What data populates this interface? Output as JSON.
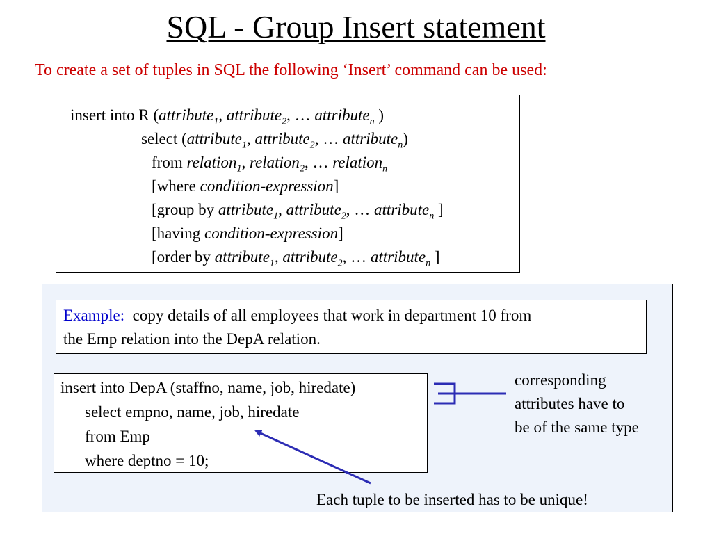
{
  "title": "SQL - Group Insert statement",
  "subtitle": "To create a set of tuples in SQL the following ‘Insert’ command can be used:",
  "colors": {
    "subtitle": "#cc0000",
    "example_label": "#0000cc",
    "panel_background": "#eef3fb",
    "connector": "#2c2cb4"
  },
  "syntax": {
    "insert_into": "insert into R (",
    "select": "select (",
    "from": "from ",
    "where_open": "[where ",
    "group_by_open": "[group by ",
    "having_open": "[having ",
    "order_by_open": "[order by ",
    "attribute": "attribute",
    "relation": "relation",
    "condition_expression": "condition-expression",
    "sub_1": "1",
    "sub_2": "2",
    "sub_n": "n",
    "comma": ", ",
    "ellipsis": ", … ",
    "close_paren": ")",
    "space_close_paren": " )",
    "close_bracket": "]",
    "space_close_bracket": " ]"
  },
  "example": {
    "label": "Example:",
    "line1": "copy details of all employees that work in department 10 from",
    "line2": "the Emp relation into the DepA relation."
  },
  "code": {
    "line1": "insert into DepA (staffno, name, job, hiredate)",
    "line2": "select empno, name, job, hiredate",
    "line3": "from  Emp",
    "line4": "where deptno = 10;"
  },
  "notes": {
    "corresponding_line1": "corresponding",
    "corresponding_line2": "attributes have to",
    "corresponding_line3": "be of the same type",
    "unique": "Each tuple to be inserted has to be unique!"
  }
}
